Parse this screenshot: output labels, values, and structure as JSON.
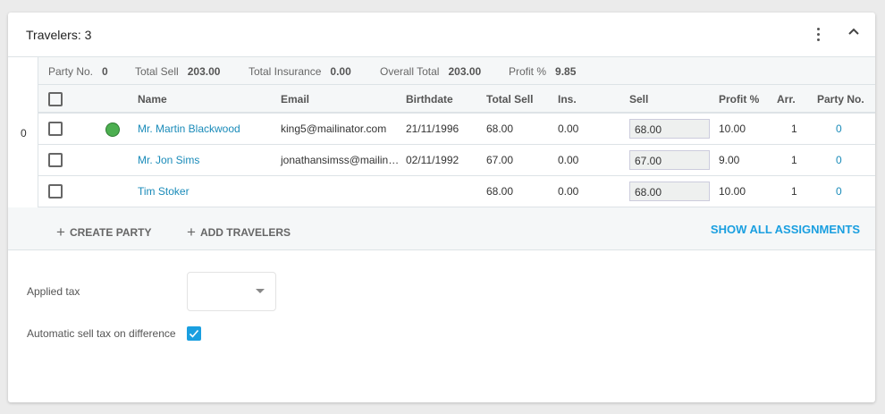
{
  "title": "Travelers: 3",
  "group_index": "0",
  "summary": {
    "party_label": "Party No.",
    "party": "0",
    "total_sell_label": "Total Sell",
    "total_sell": "203.00",
    "total_ins_label": "Total Insurance",
    "total_ins": "0.00",
    "overall_label": "Overall Total",
    "overall": "203.00",
    "profit_label": "Profit %",
    "profit": "9.85"
  },
  "columns": {
    "name": "Name",
    "email": "Email",
    "birthdate": "Birthdate",
    "total_sell": "Total Sell",
    "ins": "Ins.",
    "sell": "Sell",
    "profit": "Profit %",
    "arr": "Arr.",
    "party": "Party No."
  },
  "rows": [
    {
      "name": "Mr. Martin Blackwood",
      "email": "king5@mailinator.com",
      "birthdate": "21/11/1996",
      "total_sell": "68.00",
      "ins": "0.00",
      "sell": "68.00",
      "profit": "10.00",
      "arr": "1",
      "party": "0",
      "status": "#4caf50"
    },
    {
      "name": "Mr. Jon Sims",
      "email": "jonathansimss@mailin…",
      "birthdate": "02/11/1992",
      "total_sell": "67.00",
      "ins": "0.00",
      "sell": "67.00",
      "profit": "9.00",
      "arr": "1",
      "party": "0"
    },
    {
      "name": "Tim Stoker",
      "email": "",
      "birthdate": "",
      "total_sell": "68.00",
      "ins": "0.00",
      "sell": "68.00",
      "profit": "10.00",
      "arr": "1",
      "party": "0"
    }
  ],
  "actions": {
    "create_party": "CREATE PARTY",
    "add_travelers": "ADD TRAVELERS",
    "show_all": "SHOW ALL ASSIGNMENTS"
  },
  "tax": {
    "applied_label": "Applied tax",
    "applied_value": "",
    "auto_label": "Automatic sell tax on difference",
    "auto_checked": true
  }
}
